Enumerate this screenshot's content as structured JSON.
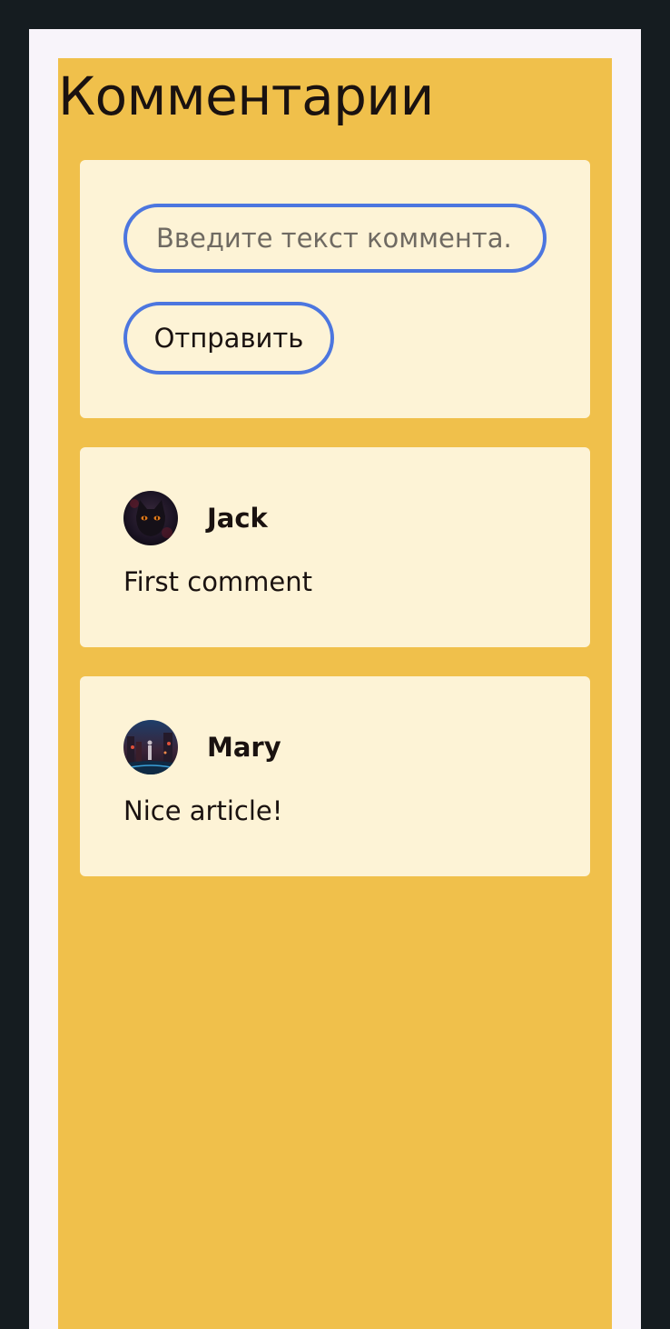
{
  "page": {
    "title": "Комментарии"
  },
  "form": {
    "input_placeholder": "Введите текст коммента...",
    "input_value": "",
    "submit_label": "Отправить"
  },
  "comments": [
    {
      "author": "Jack",
      "text": "First comment",
      "avatar": "black-cat-avatar"
    },
    {
      "author": "Mary",
      "text": "Nice article!",
      "avatar": "night-city-avatar"
    }
  ],
  "colors": {
    "background": "#151c20",
    "frame": "#f8f4fa",
    "page": "#f0c04b",
    "card": "#fdf3d6",
    "accent": "#4c76df",
    "text": "#1a1210"
  }
}
